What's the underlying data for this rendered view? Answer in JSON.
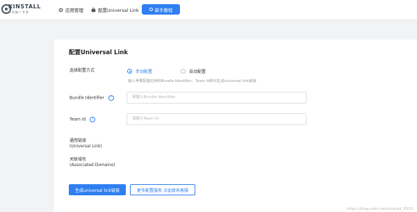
{
  "brand": {
    "name": "XINSTALL",
    "tagline": "应用推广专家"
  },
  "nav": {
    "items": [
      {
        "label": "应用管理",
        "icon": "gear-icon"
      },
      {
        "label": "配置Universal Link",
        "icon": "briefcase-icon"
      }
    ],
    "active": {
      "label": "新手教程",
      "icon": "circle-icon"
    }
  },
  "page": {
    "title": "配置Universal Link"
  },
  "config_method": {
    "label": "选择配置方式",
    "options": [
      {
        "label": "手动配置",
        "selected": true
      },
      {
        "label": "自动配置",
        "selected": false
      }
    ],
    "hint": "输入苹果配置应用的Bundle Identifier、Team Id即可生成universal link链接"
  },
  "bundle_identifier": {
    "label": "Bundle Identifier",
    "placeholder": "请输入Bundle Identifier",
    "value": ""
  },
  "team_id": {
    "label": "Team Id",
    "placeholder": "请输入Team Id",
    "value": ""
  },
  "universal_link": {
    "label": "通用链接",
    "sublabel": "(Universal Link)"
  },
  "associated_domains": {
    "label": "关联域名",
    "sublabel": "(Associated Domains)"
  },
  "buttons": {
    "generate": "生成universal link链接",
    "more": "更多配置服务 点此联系客服"
  },
  "watermark": "https://blog.csdn.net/xinstall_2020",
  "colors": {
    "accent": "#2f7ff0",
    "background": "#f2f3f5"
  }
}
